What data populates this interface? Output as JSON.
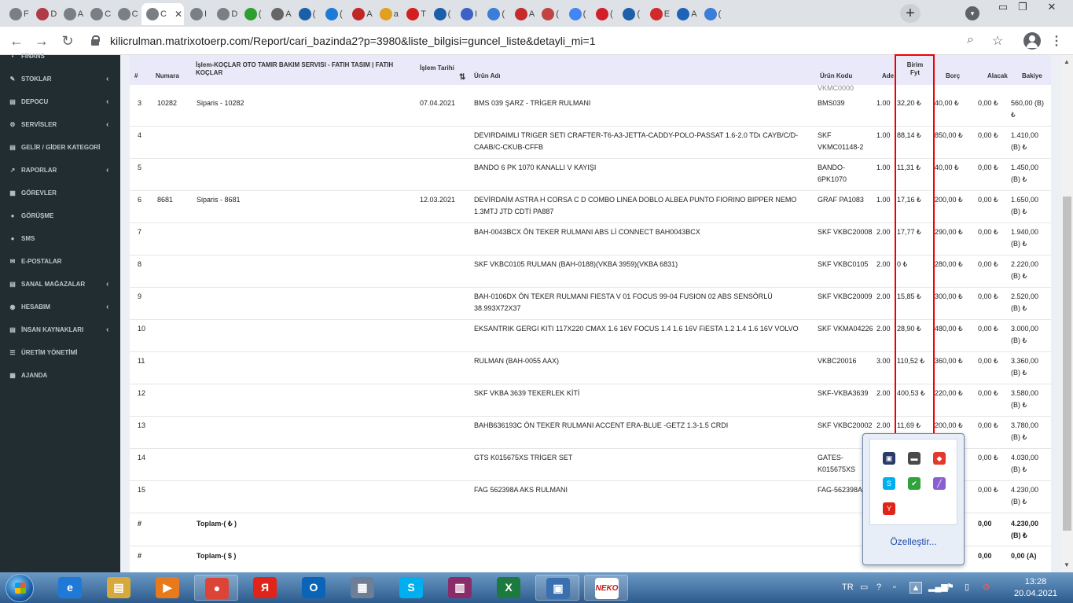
{
  "browser": {
    "tabs": [
      {
        "icon": "globe-icon",
        "text": "F",
        "color": "#7a7f86"
      },
      {
        "icon": "brand-logo-icon",
        "text": "D",
        "color": "#b03a48"
      },
      {
        "icon": "globe-icon",
        "text": "A",
        "color": "#7a7f86"
      },
      {
        "icon": "globe-icon",
        "text": "C",
        "color": "#7a7f86"
      },
      {
        "icon": "globe-icon",
        "text": "C",
        "color": "#7a7f86"
      },
      {
        "icon": "globe-icon",
        "text": "I",
        "color": "#7a7f86"
      },
      {
        "icon": "globe-icon",
        "text": "D",
        "color": "#7a7f86"
      },
      {
        "icon": "green-one-icon",
        "text": "(",
        "color": "#2e9e2e"
      },
      {
        "icon": "gear-icon",
        "text": "A",
        "color": "#666"
      },
      {
        "icon": "u-shield-icon",
        "text": "(",
        "color": "#1a5fa8"
      },
      {
        "icon": "ob-logo-icon",
        "text": "(",
        "color": "#1d7bd8"
      },
      {
        "icon": "circle-logo-icon",
        "text": "A",
        "color": "#c02828"
      },
      {
        "icon": "pencil-icon",
        "text": "a",
        "color": "#e0a020"
      },
      {
        "icon": "t-logo-icon",
        "text": "T",
        "color": "#d21f1f"
      },
      {
        "icon": "u-shield-icon",
        "text": "(",
        "color": "#1a5fa8"
      },
      {
        "icon": "puzzle-icon",
        "text": "I",
        "color": "#3b62c4"
      },
      {
        "icon": "circle-logo-icon",
        "text": "(",
        "color": "#3b7dd8"
      },
      {
        "icon": "triangle-logo-icon",
        "text": "A",
        "color": "#c52b2b"
      },
      {
        "icon": "car-logo-icon",
        "text": "(",
        "color": "#c24343"
      },
      {
        "icon": "google-icon",
        "text": "(",
        "color": "#4285f4"
      },
      {
        "icon": "pinterest-icon",
        "text": "(",
        "color": "#d0202a"
      },
      {
        "icon": "e-logo-icon",
        "text": "(",
        "color": "#1f5faa"
      },
      {
        "icon": "s-logo-icon",
        "text": "E",
        "color": "#d12a2a"
      },
      {
        "icon": "a-logo-icon",
        "text": "A",
        "color": "#1f63b8"
      },
      {
        "icon": "globe-icon",
        "text": "(",
        "color": "#3b7dd8"
      }
    ],
    "active_tab": {
      "text": "C",
      "close": "✕"
    },
    "new_tab": "+",
    "url": "kilicrulman.matrixotoerp.com/Report/cari_bazinda2?p=3980&liste_bilgisi=guncel_liste&detayli_mi=1",
    "nav": {
      "back": "←",
      "forward": "→",
      "reload": "↻"
    },
    "window": {
      "minimize": "▭",
      "restore": "❐",
      "close": "✕"
    }
  },
  "sidebar": {
    "items": [
      {
        "label": "FİNANS",
        "icon": "finance-icon",
        "glyph": "▪",
        "chevron": false
      },
      {
        "label": "STOKLAR",
        "icon": "stock-icon",
        "glyph": "✎",
        "chevron": true
      },
      {
        "label": "DEPOCU",
        "icon": "warehouse-icon",
        "glyph": "▤",
        "chevron": true
      },
      {
        "label": "SERVİSLER",
        "icon": "services-icon",
        "glyph": "⚙",
        "chevron": true
      },
      {
        "label": "GELİR / GİDER KATEGORİ",
        "icon": "category-icon",
        "glyph": "▤",
        "chevron": false
      },
      {
        "label": "RAPORLAR",
        "icon": "chart-icon",
        "glyph": "↗",
        "chevron": true
      },
      {
        "label": "GÖREVLER",
        "icon": "tasks-icon",
        "glyph": "▦",
        "chevron": false
      },
      {
        "label": "GÖRÜŞME",
        "icon": "meeting-icon",
        "glyph": "●",
        "chevron": false
      },
      {
        "label": "SMS",
        "icon": "sms-icon",
        "glyph": "●",
        "chevron": false
      },
      {
        "label": "E-POSTALAR",
        "icon": "mail-icon",
        "glyph": "✉",
        "chevron": false
      },
      {
        "label": "SANAL MAĞAZALAR",
        "icon": "store-icon",
        "glyph": "▤",
        "chevron": true
      },
      {
        "label": "HESABIM",
        "icon": "account-icon",
        "glyph": "◉",
        "chevron": true
      },
      {
        "label": "İNSAN KAYNAKLARI",
        "icon": "hr-icon",
        "glyph": "▤",
        "chevron": true
      },
      {
        "label": "ÜRETİM YÖNETİMİ",
        "icon": "production-icon",
        "glyph": "☰",
        "chevron": false
      },
      {
        "label": "AJANDA",
        "icon": "calendar-icon",
        "glyph": "▦",
        "chevron": false
      }
    ],
    "chevron_glyph": "‹"
  },
  "table": {
    "headers": {
      "no": "#",
      "numara": "Numara",
      "islem": "İşlem-KOÇLAR OTO TAMIR BAKIM SERVISI - FATIH TASIM | FATIH KOÇLAR",
      "tarih": "İşlem Tarihi",
      "sort": "⇅",
      "urun": "Ürün Adı",
      "kod": "Ürün Kodu",
      "adet": "Ade",
      "fiyat": "Birim Fyt",
      "borc": "Borç",
      "alacak": "Alacak",
      "bakiye": "Bakiye"
    },
    "partial_row_code": "VKMC0000",
    "rows": [
      {
        "no": "3",
        "numara": "10282",
        "islem": "Siparis - 10282",
        "tarih": "07.04.2021",
        "urun": "BMS 039 ŞARZ - TRİGER RULMANI",
        "kod": "BMS039",
        "adet": "1.00",
        "fiyat": "32,20 ₺",
        "borc": "40,00 ₺",
        "alacak": "0,00 ₺",
        "bakiye": "560,00 (B) ₺"
      },
      {
        "no": "4",
        "numara": "",
        "islem": "",
        "tarih": "",
        "urun": "DEVIRDAIMLI TRIGER SETI CRAFTER-T6-A3-JETTA-CADDY-POLO-PASSAT 1.6-2.0 TDı CAYB/C/D-CAAB/C-CKUB-CFFB",
        "kod": "SKF VKMC01148-2",
        "adet": "1.00",
        "fiyat": "88,14 ₺",
        "borc": "850,00 ₺",
        "alacak": "0,00 ₺",
        "bakiye": "1.410,00 (B) ₺"
      },
      {
        "no": "5",
        "numara": "",
        "islem": "",
        "tarih": "",
        "urun": "BANDO 6 PK 1070 KANALLI V KAYIŞI",
        "kod": "BANDO-6PK1070",
        "adet": "1.00",
        "fiyat": "11,31 ₺",
        "borc": "40,00 ₺",
        "alacak": "0,00 ₺",
        "bakiye": "1.450,00 (B) ₺"
      },
      {
        "no": "6",
        "numara": "8681",
        "islem": "Siparis - 8681",
        "tarih": "12.03.2021",
        "urun": "DEVİRDAİM ASTRA H CORSA C D COMBO LINEA DOBLO ALBEA PUNTO FIORINO BIPPER NEMO 1.3MTJ JTD CDTİ PA887",
        "kod": "GRAF PA1083",
        "adet": "1.00",
        "fiyat": "17,16 ₺",
        "borc": "200,00 ₺",
        "alacak": "0,00 ₺",
        "bakiye": "1.650,00 (B) ₺"
      },
      {
        "no": "7",
        "numara": "",
        "islem": "",
        "tarih": "",
        "urun": "BAH-0043BCX ÖN TEKER RULMANI ABS Lİ CONNECT BAH0043BCX",
        "kod": "SKF VKBC20008",
        "adet": "2.00",
        "fiyat": "17,77 ₺",
        "borc": "290,00 ₺",
        "alacak": "0,00 ₺",
        "bakiye": "1.940,00 (B) ₺"
      },
      {
        "no": "8",
        "numara": "",
        "islem": "",
        "tarih": "",
        "urun": "SKF VKBC0105 RULMAN (BAH-0188)(VKBA 3959)(VKBA 6831)",
        "kod": "SKF VKBC0105",
        "adet": "2.00",
        "fiyat": "0 ₺",
        "borc": "280,00 ₺",
        "alacak": "0,00 ₺",
        "bakiye": "2.220,00 (B) ₺"
      },
      {
        "no": "9",
        "numara": "",
        "islem": "",
        "tarih": "",
        "urun": "BAH-0106DX ÖN TEKER RULMANI FIESTA V 01 FOCUS 99-04 FUSION 02 ABS SENSÖRLÜ 38.993X72X37",
        "kod": "SKF VKBC20009",
        "adet": "2.00",
        "fiyat": "15,85 ₺",
        "borc": "300,00 ₺",
        "alacak": "0,00 ₺",
        "bakiye": "2.520,00 (B) ₺"
      },
      {
        "no": "10",
        "numara": "",
        "islem": "",
        "tarih": "",
        "urun": "EKSANTRIK GERGI KITI 117X220 CMAX 1.6 16V FOCUS 1.4 1.6 16V FiESTA 1.2 1.4 1.6 16V VOLVO",
        "kod": "SKF VKMA04226",
        "adet": "2.00",
        "fiyat": "28,90 ₺",
        "borc": "480,00 ₺",
        "alacak": "0,00 ₺",
        "bakiye": "3.000,00 (B) ₺"
      },
      {
        "no": "11",
        "numara": "",
        "islem": "",
        "tarih": "",
        "urun": "RULMAN (BAH-0055 AAX)",
        "kod": "VKBC20016",
        "adet": "3.00",
        "fiyat": "110,52 ₺",
        "borc": "360,00 ₺",
        "alacak": "0,00 ₺",
        "bakiye": "3.360,00 (B) ₺"
      },
      {
        "no": "12",
        "numara": "",
        "islem": "",
        "tarih": "",
        "urun": "SKF VKBA 3639 TEKERLEK KİTİ",
        "kod": "SKF-VKBA3639",
        "adet": "2.00",
        "fiyat": "400,53 ₺",
        "borc": "220,00 ₺",
        "alacak": "0,00 ₺",
        "bakiye": "3.580,00 (B) ₺"
      },
      {
        "no": "13",
        "numara": "",
        "islem": "",
        "tarih": "",
        "urun": "BAHB636193C ÖN TEKER RULMANI ACCENT ERA-BLUE -GETZ 1.3-1.5 CRDI",
        "kod": "SKF VKBC20002",
        "adet": "2.00",
        "fiyat": "11,69 ₺",
        "borc": "200,00 ₺",
        "alacak": "0,00 ₺",
        "bakiye": "3.780,00 (B) ₺"
      },
      {
        "no": "14",
        "numara": "",
        "islem": "",
        "tarih": "",
        "urun": "GTS K015675XS TRİGER SET",
        "kod": "GATES-K015675XS",
        "adet": "",
        "fiyat": "",
        "borc": "",
        "alacak": "0,00 ₺",
        "bakiye": "4.030,00 (B) ₺"
      },
      {
        "no": "15",
        "numara": "",
        "islem": "",
        "tarih": "",
        "urun": "FAG 562398A AKS RULMANI",
        "kod": "FAG-562398A",
        "adet": "",
        "fiyat": "",
        "borc": "",
        "alacak": "0,00 ₺",
        "bakiye": "4.230,00 (B) ₺"
      }
    ],
    "totals": [
      {
        "no": "#",
        "label": "Toplam-( ₺ )",
        "borc": "0",
        "alacak": "0,00",
        "bakiye": "4.230,00 (B) ₺"
      },
      {
        "no": "#",
        "label": "Toplam-( $ )",
        "borc": "0,00",
        "alacak": "0,00",
        "bakiye": "0,00 (A)"
      }
    ]
  },
  "tray_popup": {
    "customize": "Özelleştir...",
    "icons": [
      {
        "name": "monitor-tray-icon",
        "glyph": "▣",
        "color": "#2a3b6a"
      },
      {
        "name": "network-tray-icon",
        "glyph": "▬",
        "color": "#4a4a4a"
      },
      {
        "name": "anydesk-tray-icon",
        "glyph": "◆",
        "color": "#e2382e"
      },
      {
        "name": "skype-tray-icon",
        "glyph": "S",
        "color": "#00aff0"
      },
      {
        "name": "check-tray-icon",
        "glyph": "✔",
        "color": "#2fa33a"
      },
      {
        "name": "pen-tray-icon",
        "glyph": "╱",
        "color": "#8a5fd0"
      },
      {
        "name": "yandex-tray-icon",
        "glyph": "Y",
        "color": "#e0241a"
      }
    ]
  },
  "taskbar": {
    "apps": [
      {
        "name": "ie-app",
        "glyph": "e",
        "color": "#1e7ad6",
        "open": false
      },
      {
        "name": "explorer-app",
        "glyph": "▤",
        "color": "#d6a93a",
        "open": false
      },
      {
        "name": "media-player-app",
        "glyph": "▶",
        "color": "#e87a1c",
        "open": false
      },
      {
        "name": "chrome-app",
        "glyph": "●",
        "color": "#db4437",
        "open": true
      },
      {
        "name": "yandex-app",
        "glyph": "Я",
        "color": "#e0241a",
        "open": false
      },
      {
        "name": "outlook-app",
        "glyph": "O",
        "color": "#0a64b8",
        "open": false
      },
      {
        "name": "calculator-app",
        "glyph": "▦",
        "color": "#6d7f96",
        "open": false
      },
      {
        "name": "skype-app",
        "glyph": "S",
        "color": "#00aff0",
        "open": false
      },
      {
        "name": "winrar-app",
        "glyph": "▥",
        "color": "#8a2b6a",
        "open": false
      },
      {
        "name": "excel-app",
        "glyph": "X",
        "color": "#1d7a3e",
        "open": false
      },
      {
        "name": "remote-desktop-app",
        "glyph": "▣",
        "color": "#3a6fb0",
        "open": true
      },
      {
        "name": "neko-app",
        "glyph": "NEKO",
        "color": "#ffffff",
        "open": true
      }
    ],
    "lang": "TR",
    "time": "13:28",
    "date": "20.04.2021"
  }
}
